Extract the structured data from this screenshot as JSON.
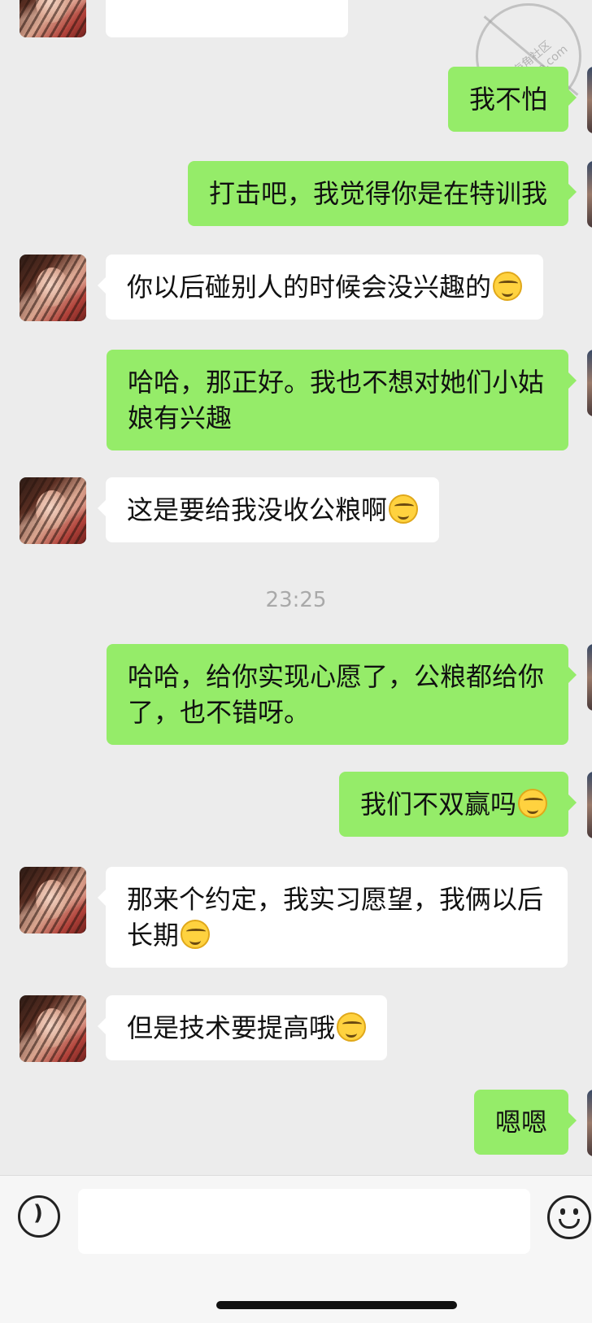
{
  "messages": [
    {
      "side": "out",
      "text": "我不怕",
      "emoji": false
    },
    {
      "side": "out",
      "text": "打击吧，我觉得你是在特训我",
      "emoji": false
    },
    {
      "side": "in",
      "text": "你以后碰别人的时候会没兴趣的",
      "emoji": true
    },
    {
      "side": "out",
      "text": "哈哈，那正好。我也不想对她们小姑娘有兴趣",
      "emoji": false
    },
    {
      "side": "in",
      "text": "这是要给我没收公粮啊",
      "emoji": true
    },
    {
      "side": "out",
      "text": "哈哈，给你实现心愿了，公粮都给你了，也不错呀。",
      "emoji": false
    },
    {
      "side": "out",
      "text": "我们不双赢吗",
      "emoji": true
    },
    {
      "side": "in",
      "text": "那来个约定，我实习愿望，我俩以后长期",
      "emoji": true
    },
    {
      "side": "in",
      "text": "但是技术要提高哦",
      "emoji": true
    },
    {
      "side": "out",
      "text": "嗯嗯",
      "emoji": false
    }
  ],
  "timestamp": "23:25",
  "watermark": {
    "text": "海角社区 haijiao.com"
  },
  "input": {
    "value": "",
    "placeholder": ""
  },
  "icons": {
    "voice": "voice-icon",
    "emoji": "emoji-icon"
  }
}
